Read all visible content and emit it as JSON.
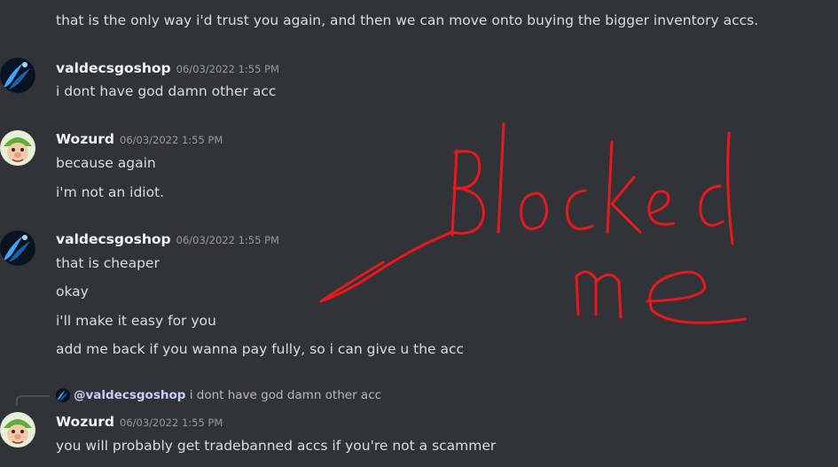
{
  "prev_message": {
    "text": "that is the only way i'd trust you again, and then we can move onto buying the bigger inventory accs."
  },
  "messages": [
    {
      "author": "valdecsgoshop",
      "timestamp": "06/03/2022 1:55 PM",
      "lines": [
        "i dont have god damn other acc"
      ]
    },
    {
      "author": "Wozurd",
      "timestamp": "06/03/2022 1:55 PM",
      "lines": [
        "because again",
        "i'm not an idiot."
      ]
    },
    {
      "author": "valdecsgoshop",
      "timestamp": "06/03/2022 1:55 PM",
      "lines": [
        "that is cheaper",
        "okay",
        "i'll make it easy for you",
        "add me back if you wanna pay fully, so i can give u the acc"
      ]
    },
    {
      "reply": {
        "mention": "@valdecsgoshop",
        "text": "i dont have god damn other acc"
      },
      "author": "Wozurd",
      "timestamp": "06/03/2022 1:55 PM",
      "lines": [
        "you will probably get tradebanned accs if you're not a scammer"
      ]
    }
  ],
  "annotation": {
    "text": "Blocked me",
    "color": "#e8181b"
  },
  "colors": {
    "background": "#313338",
    "text": "#dbdee1",
    "author": "#f2f3f5",
    "timestamp": "#949ba4"
  },
  "icons": {
    "avatar_valdecsgoshop": "blue-blade-avatar-icon",
    "avatar_wozurd": "elf-face-avatar-icon"
  }
}
